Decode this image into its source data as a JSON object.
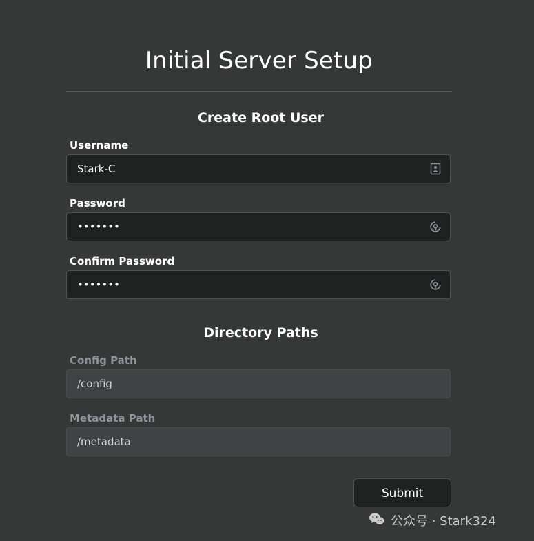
{
  "page": {
    "title": "Initial Server Setup"
  },
  "sections": {
    "root_user": {
      "title": "Create Root User",
      "username": {
        "label": "Username",
        "value": "Stark-C",
        "icon": "contact-card-icon"
      },
      "password": {
        "label": "Password",
        "value": "•••••••",
        "icon": "key-icon"
      },
      "confirm_password": {
        "label": "Confirm Password",
        "value": "•••••••",
        "icon": "key-icon"
      }
    },
    "directory_paths": {
      "title": "Directory Paths",
      "config_path": {
        "label": "Config Path",
        "value": "/config"
      },
      "metadata_path": {
        "label": "Metadata Path",
        "value": "/metadata"
      }
    }
  },
  "actions": {
    "submit_label": "Submit"
  },
  "watermark": {
    "text": "公众号 · Stark324"
  },
  "colors": {
    "background": "#363737",
    "input_bg": "#202121",
    "readonly_bg": "#414243",
    "muted_label": "#8d949a"
  }
}
